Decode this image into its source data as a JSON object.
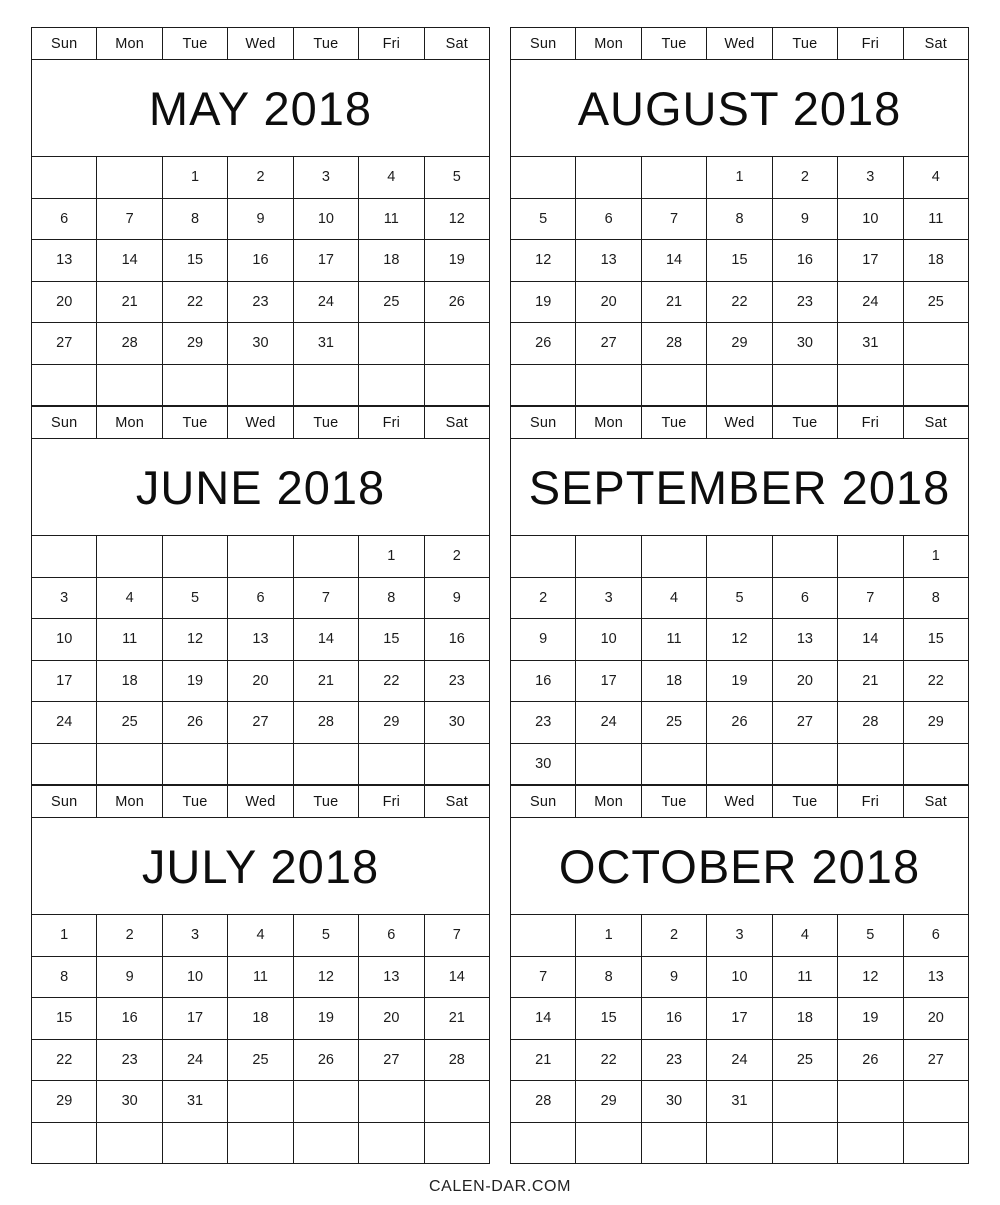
{
  "site": {
    "footer_text": "CALEN-DAR.COM"
  },
  "weekday_headers": [
    "Sun",
    "Mon",
    "Tue",
    "Wed",
    "Tue",
    "Fri",
    "Sat"
  ],
  "columns": [
    {
      "name": "left-column",
      "months": [
        {
          "title": "MAY 2018",
          "month": "May",
          "year": "2018",
          "first_weekday_index": 2,
          "days_in_month": 31,
          "weeks": [
            [
              "",
              "",
              "1",
              "2",
              "3",
              "4",
              "5"
            ],
            [
              "6",
              "7",
              "8",
              "9",
              "10",
              "11",
              "12"
            ],
            [
              "13",
              "14",
              "15",
              "16",
              "17",
              "18",
              "19"
            ],
            [
              "20",
              "21",
              "22",
              "23",
              "24",
              "25",
              "26"
            ],
            [
              "27",
              "28",
              "29",
              "30",
              "31",
              "",
              ""
            ],
            [
              "",
              "",
              "",
              "",
              "",
              "",
              ""
            ]
          ]
        },
        {
          "title": "JUNE 2018",
          "month": "June",
          "year": "2018",
          "first_weekday_index": 5,
          "days_in_month": 30,
          "weeks": [
            [
              "",
              "",
              "",
              "",
              "",
              "1",
              "2"
            ],
            [
              "3",
              "4",
              "5",
              "6",
              "7",
              "8",
              "9"
            ],
            [
              "10",
              "11",
              "12",
              "13",
              "14",
              "15",
              "16"
            ],
            [
              "17",
              "18",
              "19",
              "20",
              "21",
              "22",
              "23"
            ],
            [
              "24",
              "25",
              "26",
              "27",
              "28",
              "29",
              "30"
            ],
            [
              "",
              "",
              "",
              "",
              "",
              "",
              ""
            ]
          ]
        },
        {
          "title": "JULY 2018",
          "month": "July",
          "year": "2018",
          "first_weekday_index": 0,
          "days_in_month": 31,
          "weeks": [
            [
              "1",
              "2",
              "3",
              "4",
              "5",
              "6",
              "7"
            ],
            [
              "8",
              "9",
              "10",
              "11",
              "12",
              "13",
              "14"
            ],
            [
              "15",
              "16",
              "17",
              "18",
              "19",
              "20",
              "21"
            ],
            [
              "22",
              "23",
              "24",
              "25",
              "26",
              "27",
              "28"
            ],
            [
              "29",
              "30",
              "31",
              "",
              "",
              "",
              ""
            ],
            [
              "",
              "",
              "",
              "",
              "",
              "",
              ""
            ]
          ]
        }
      ]
    },
    {
      "name": "right-column",
      "months": [
        {
          "title": "AUGUST 2018",
          "month": "August",
          "year": "2018",
          "first_weekday_index": 3,
          "days_in_month": 31,
          "weeks": [
            [
              "",
              "",
              "",
              "1",
              "2",
              "3",
              "4"
            ],
            [
              "5",
              "6",
              "7",
              "8",
              "9",
              "10",
              "11"
            ],
            [
              "12",
              "13",
              "14",
              "15",
              "16",
              "17",
              "18"
            ],
            [
              "19",
              "20",
              "21",
              "22",
              "23",
              "24",
              "25"
            ],
            [
              "26",
              "27",
              "28",
              "29",
              "30",
              "31",
              ""
            ],
            [
              "",
              "",
              "",
              "",
              "",
              "",
              ""
            ]
          ]
        },
        {
          "title": "SEPTEMBER 2018",
          "month": "September",
          "year": "2018",
          "first_weekday_index": 6,
          "days_in_month": 30,
          "weeks": [
            [
              "",
              "",
              "",
              "",
              "",
              "",
              "1"
            ],
            [
              "2",
              "3",
              "4",
              "5",
              "6",
              "7",
              "8"
            ],
            [
              "9",
              "10",
              "11",
              "12",
              "13",
              "14",
              "15"
            ],
            [
              "16",
              "17",
              "18",
              "19",
              "20",
              "21",
              "22"
            ],
            [
              "23",
              "24",
              "25",
              "26",
              "27",
              "28",
              "29"
            ],
            [
              "30",
              "",
              "",
              "",
              "",
              "",
              ""
            ]
          ]
        },
        {
          "title": "OCTOBER 2018",
          "month": "October",
          "year": "2018",
          "first_weekday_index": 1,
          "days_in_month": 31,
          "weeks": [
            [
              "",
              "1",
              "2",
              "3",
              "4",
              "5",
              "6"
            ],
            [
              "7",
              "8",
              "9",
              "10",
              "11",
              "12",
              "13"
            ],
            [
              "14",
              "15",
              "16",
              "17",
              "18",
              "19",
              "20"
            ],
            [
              "21",
              "22",
              "23",
              "24",
              "25",
              "26",
              "27"
            ],
            [
              "28",
              "29",
              "30",
              "31",
              "",
              "",
              ""
            ],
            [
              "",
              "",
              "",
              "",
              "",
              "",
              ""
            ]
          ]
        }
      ]
    }
  ]
}
